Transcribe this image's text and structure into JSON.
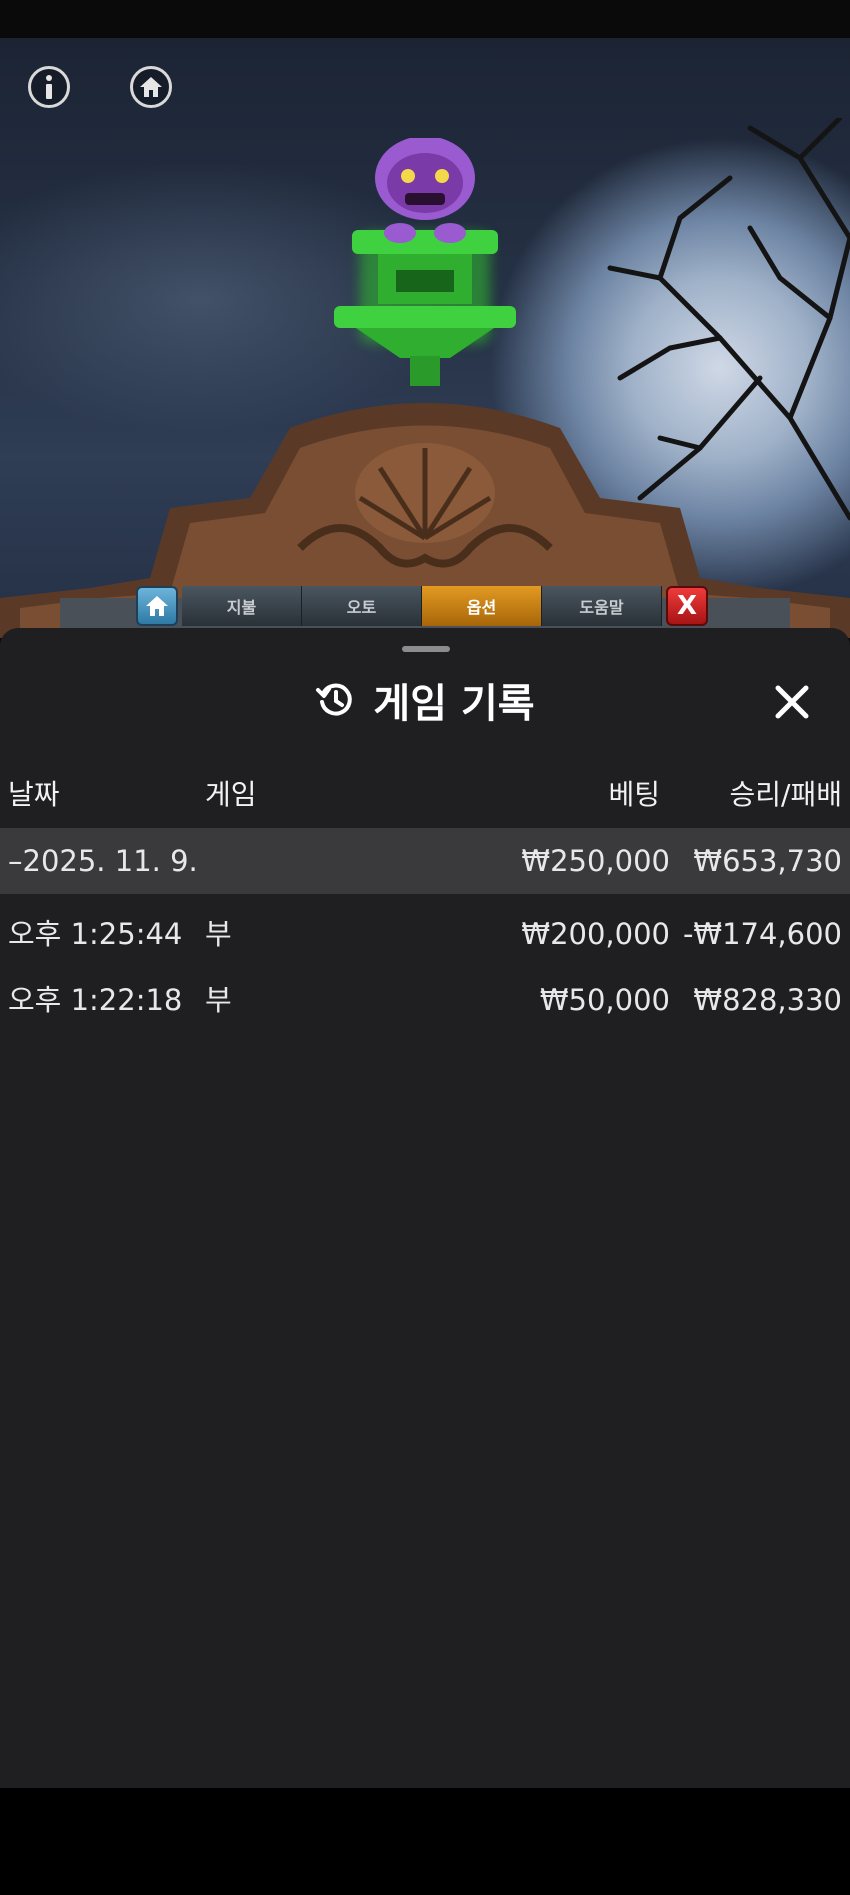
{
  "game_menu": {
    "tabs": [
      {
        "label": "지불",
        "active": false
      },
      {
        "label": "오토",
        "active": false
      },
      {
        "label": "옵션",
        "active": true
      },
      {
        "label": "도움말",
        "active": false
      }
    ],
    "close_label": "X"
  },
  "history": {
    "title": "게임 기록",
    "columns": {
      "date": "날짜",
      "game": "게임",
      "bet": "베팅",
      "win_loss": "승리/패배"
    },
    "date_group": {
      "label": "–2025. 11. 9.",
      "bet": "₩250,000",
      "win_loss": "₩653,730"
    },
    "rows": [
      {
        "time": "오후 1:25:44",
        "game": "부",
        "bet": "₩200,000",
        "win_loss": "-₩174,600"
      },
      {
        "time": "오후 1:22:18",
        "game": "부",
        "bet": "₩50,000",
        "win_loss": "₩828,330"
      }
    ]
  },
  "colors": {
    "sheet_bg": "#1f1f21",
    "date_row_bg": "#3a3a3c",
    "active_tab": "#e29a22",
    "monster_green": "#3fd13f",
    "monster_purple": "#9a5ad0"
  }
}
